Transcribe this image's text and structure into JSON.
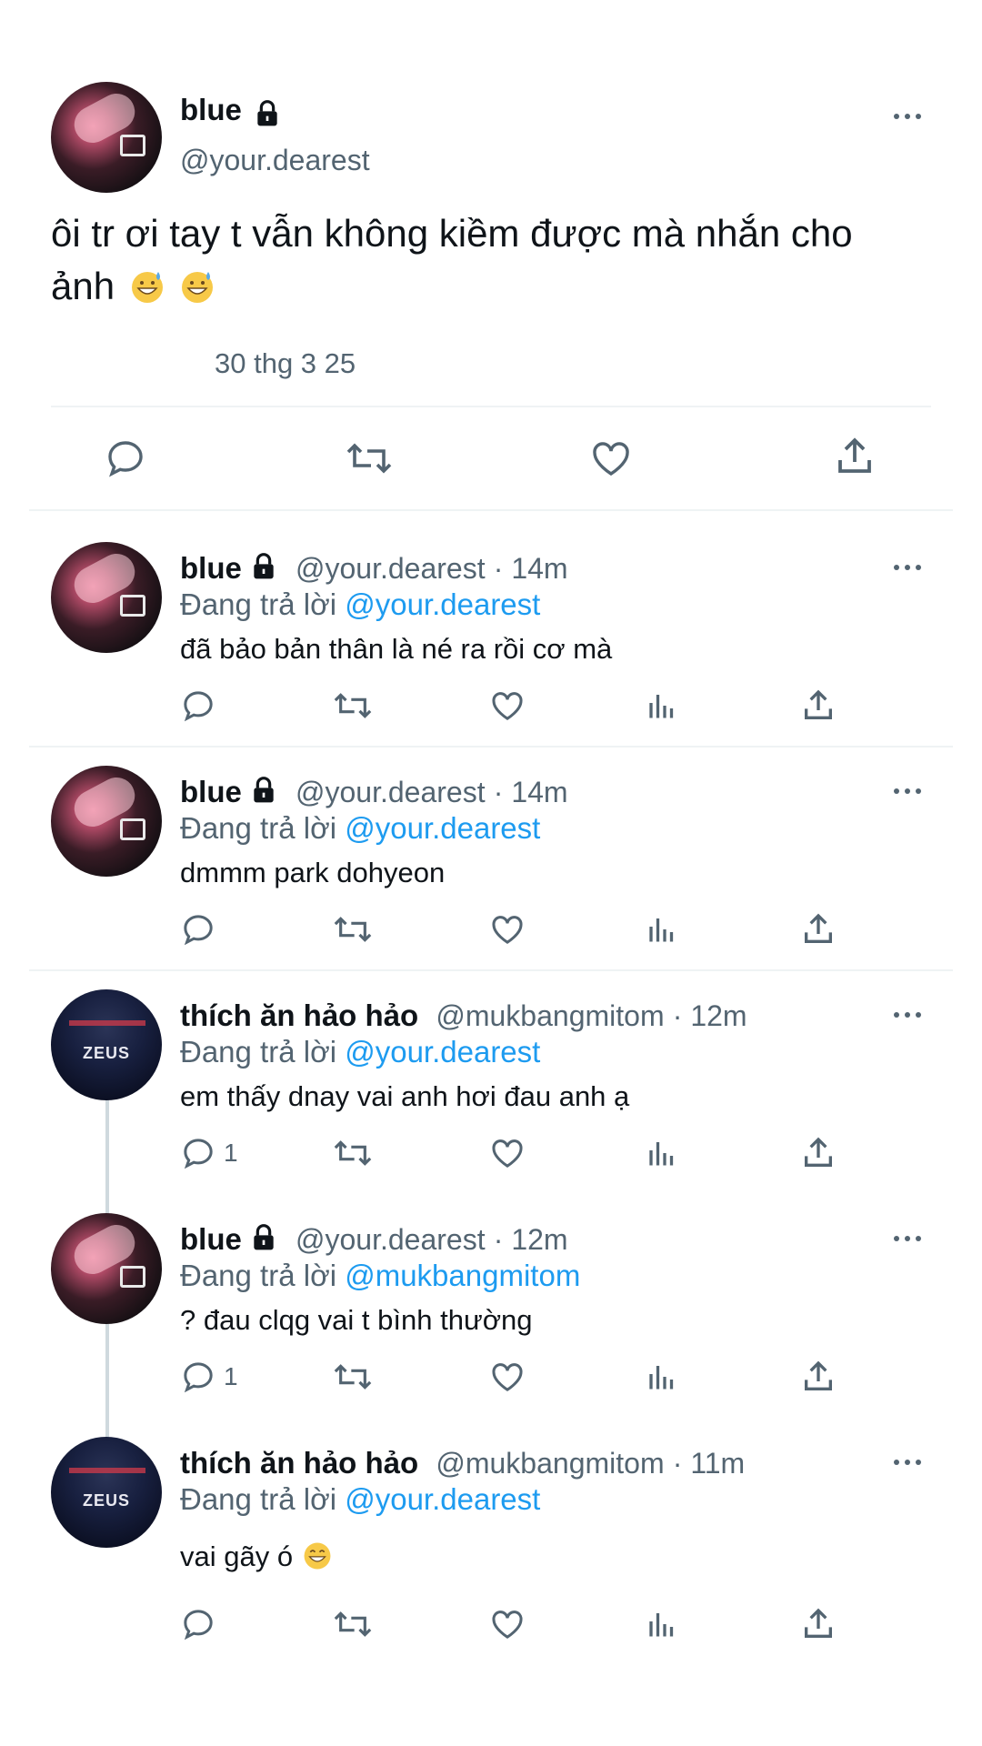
{
  "main_tweet": {
    "name": "blue",
    "handle": "@your.dearest",
    "text": "ôi tr ơi tay t vẫn không kiềm được mà nhắn cho ảnh",
    "date": "30 thg 3 25",
    "emoji": "grinning-face-with-sweat"
  },
  "reply_prefix": "Đang trả lời",
  "replies": [
    {
      "name": "blue",
      "handle": "@your.dearest",
      "time": "14m",
      "reply_to": "@your.dearest",
      "text": "đã bảo bản thân là né ra rồi cơ mà",
      "reply_count": "",
      "avatar": "blue",
      "locked": true
    },
    {
      "name": "blue",
      "handle": "@your.dearest",
      "time": "14m",
      "reply_to": "@your.dearest",
      "text": "dmmm park dohyeon",
      "reply_count": "",
      "avatar": "blue",
      "locked": true
    },
    {
      "name": "thích ăn hảo hảo",
      "handle": "@mukbangmitom",
      "time": "12m",
      "reply_to": "@your.dearest",
      "text": "em thấy dnay vai anh hơi đau anh ạ",
      "reply_count": "1",
      "avatar": "zeus",
      "locked": false
    },
    {
      "name": "blue",
      "handle": "@your.dearest",
      "time": "12m",
      "reply_to": "@mukbangmitom",
      "text": "? đau clqg vai t bình thường",
      "reply_count": "1",
      "avatar": "blue",
      "locked": true
    },
    {
      "name": "thích ăn hảo hảo",
      "handle": "@mukbangmitom",
      "time": "11m",
      "reply_to": "@your.dearest",
      "text": "vai gãy ó",
      "reply_count": "",
      "avatar": "zeus",
      "locked": false
    }
  ],
  "avatar_labels": {
    "zeus": "ZEUS"
  },
  "separator": "·",
  "colors": {
    "link": "#1d9bf0",
    "secondary": "#536471",
    "text": "#0f1419",
    "divider": "#eff3f4"
  }
}
